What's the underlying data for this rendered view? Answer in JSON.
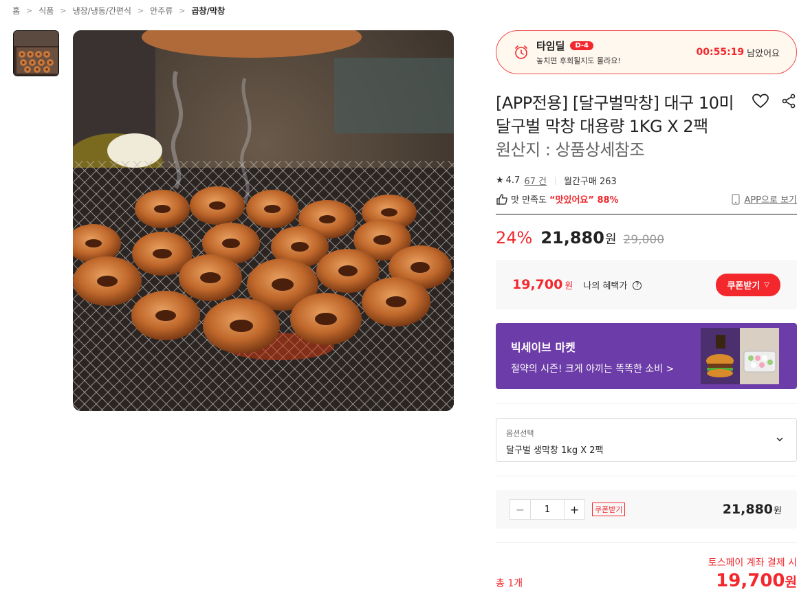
{
  "breadcrumb": [
    "홈",
    "식품",
    "냉장/냉동/간편식",
    "안주류",
    "곱창/막창"
  ],
  "timedeal": {
    "title": "타임딜",
    "badge": "D-4",
    "subtitle": "놓치면 후회될지도 몰라요!",
    "timer": "00:55:19",
    "remain_label": "남았어요"
  },
  "product": {
    "title": "[APP전용] [달구벌막창] 대구 10미 달구벌 막창 대용량 1KG X 2팩",
    "origin": "원산지 : 상품상세참조",
    "rating": "4.7",
    "review_count": "67 건",
    "monthly_sales": "월간구매 263",
    "taste_prefix": "맛 만족도",
    "taste_highlight": "“맛있어요” 88%",
    "app_view": "APP으로 보기"
  },
  "price": {
    "discount": "24%",
    "sale": "21,880",
    "won": "원",
    "original": "29,000"
  },
  "benefit": {
    "price": "19,700",
    "won": "원",
    "label": "나의 혜택가",
    "help": "?",
    "coupon_button": "쿠폰받기"
  },
  "banner": {
    "title": "빅세이브 마켓",
    "subtitle": "절약의 시즌! 크게 아끼는 똑똑한 소비 >"
  },
  "option": {
    "label": "옵션선택",
    "value": "달구벌 생막창 1kg X 2팩"
  },
  "quantity": {
    "value": "1",
    "minus": "−",
    "plus": "+",
    "coupon_tag": "쿠폰받기",
    "price": "21,880",
    "won": "원"
  },
  "total": {
    "count": "총 1개",
    "toss_label": "토스페이 계좌 결제 시",
    "price": "19,700",
    "won": "원"
  },
  "colors": {
    "accent_red": "#f2282d",
    "banner_purple": "#6c3ca8"
  },
  "icons": [
    "alarm-clock-icon",
    "heart-icon",
    "share-icon",
    "star-icon",
    "thumbs-up-icon",
    "phone-icon",
    "chevron-down-icon"
  ]
}
